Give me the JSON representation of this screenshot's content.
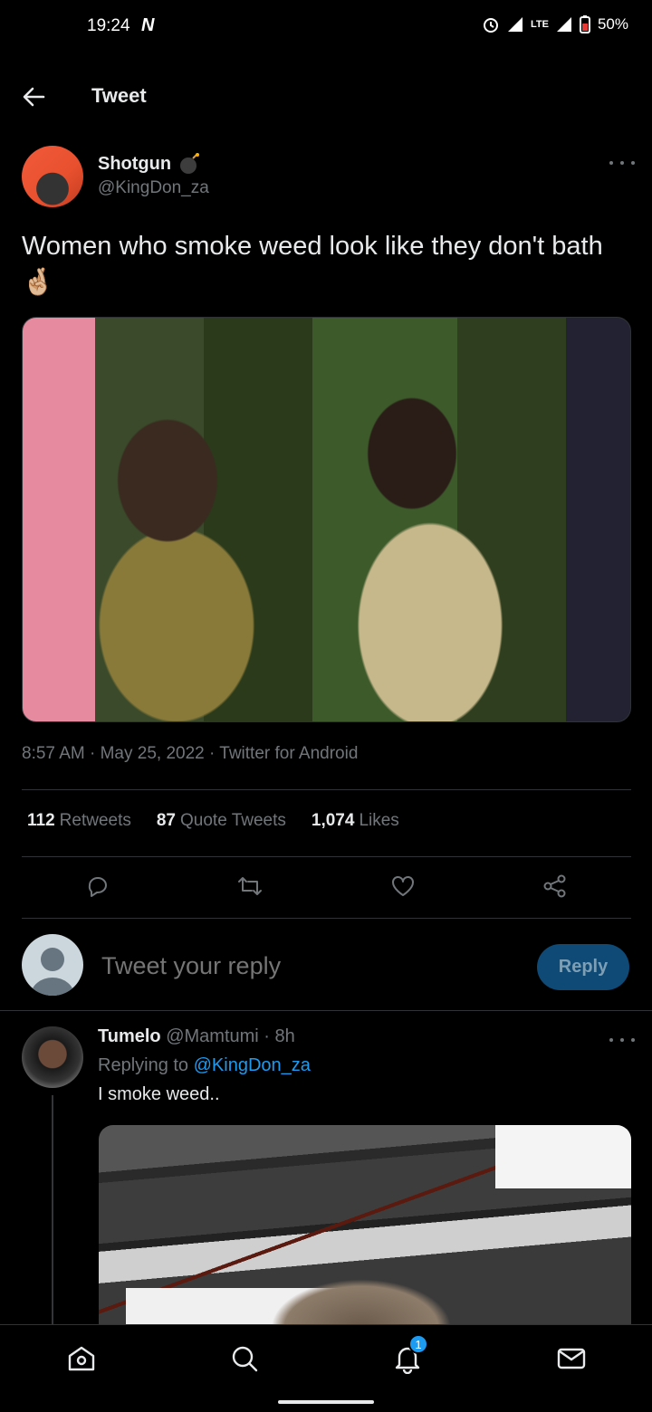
{
  "status_bar": {
    "time": "19:24",
    "carrier_logo": "N",
    "network": "LTE",
    "battery": "50%"
  },
  "header": {
    "title": "Tweet",
    "back_icon": "arrow-left-icon"
  },
  "tweet": {
    "author_name": "Shotgun",
    "author_handle": "@KingDon_za",
    "text": "Women who smoke weed look like they don't bath 🤞🏼",
    "timestamp": "8:57 AM · May 25, 2022 · Twitter for Android",
    "stats": {
      "retweets_count": "112",
      "retweets_label": "Retweets",
      "quote_count": "87",
      "quote_label": "Quote Tweets",
      "likes_count": "1,074",
      "likes_label": "Likes"
    },
    "actions": [
      "reply-icon",
      "retweet-icon",
      "like-icon",
      "share-icon"
    ]
  },
  "composer": {
    "placeholder": "Tweet your reply",
    "button_label": "Reply"
  },
  "reply": {
    "author_name": "Tumelo",
    "author_handle": "@Mamtumi",
    "time": "8h",
    "replying_prefix": "Replying to",
    "replying_to": "@KingDon_za",
    "text": "I smoke weed.."
  },
  "bottom_nav": {
    "items": [
      "home-icon",
      "search-icon",
      "notifications-icon",
      "messages-icon"
    ],
    "notification_badge": "1"
  },
  "colors": {
    "background": "#000000",
    "text": "#e7e9ea",
    "secondary": "#71767b",
    "accent": "#1d9bf0",
    "divider": "#2f3336"
  }
}
